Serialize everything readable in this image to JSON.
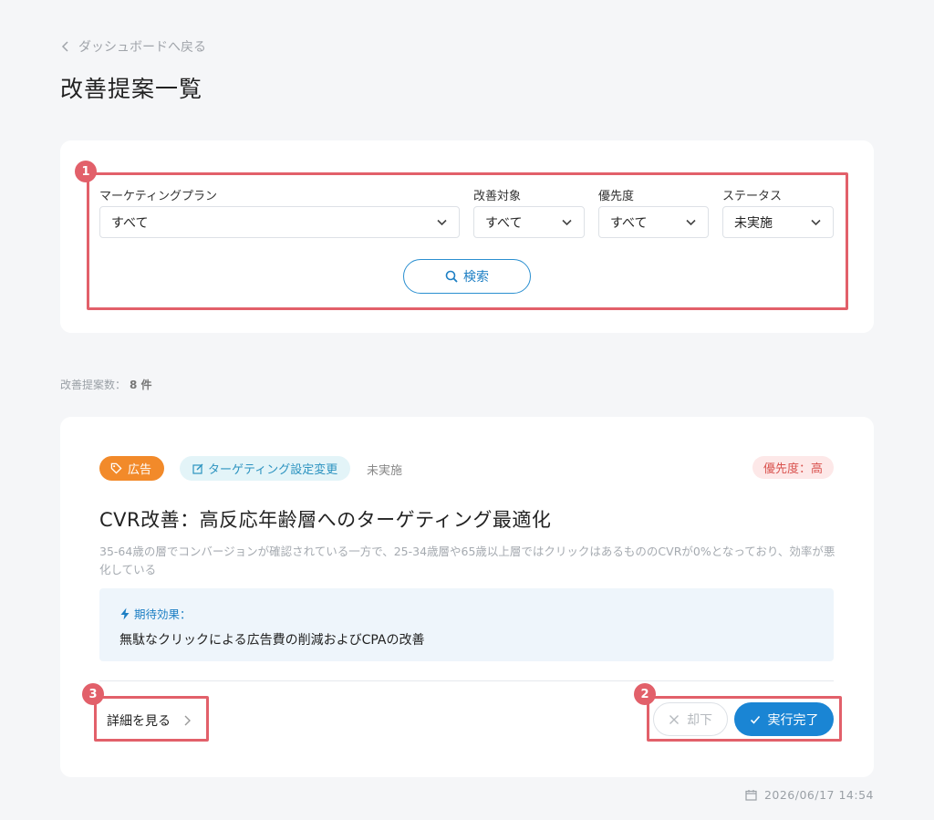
{
  "nav": {
    "back_label": "ダッシュボードへ戻る"
  },
  "page": {
    "title": "改善提案一覧"
  },
  "filters": {
    "plan": {
      "label": "マーケティングプラン",
      "value": "すべて"
    },
    "target": {
      "label": "改善対象",
      "value": "すべて"
    },
    "priority": {
      "label": "優先度",
      "value": "すべて"
    },
    "status": {
      "label": "ステータス",
      "value": "未実施"
    },
    "search_label": "検索"
  },
  "summary": {
    "label": "改善提案数：",
    "count": "8 件"
  },
  "suggestion": {
    "category_tag": "広告",
    "type_tag": "ターゲティング設定変更",
    "status": "未実施",
    "priority": "優先度：高",
    "title": "CVR改善：高反応年齢層へのターゲティング最適化",
    "description": "35-64歳の層でコンバージョンが確認されている一方で、25-34歳層や65歳以上層ではクリックはあるもののCVRが0%となっており、効率が悪化している",
    "effect_label": "期待効果：",
    "effect_text": "無駄なクリックによる広告費の削減およびCPAの改善",
    "detail_label": "詳細を見る",
    "reject_label": "却下",
    "complete_label": "実行完了"
  },
  "annotations": [
    "1",
    "2",
    "3"
  ],
  "footer": {
    "timestamp": "2026/06/17 14:54"
  },
  "colors": {
    "accent_blue": "#1a85d4",
    "annotation_red": "#e2606a",
    "tag_orange": "#f28a2a",
    "priority_red": "#d9534f"
  }
}
